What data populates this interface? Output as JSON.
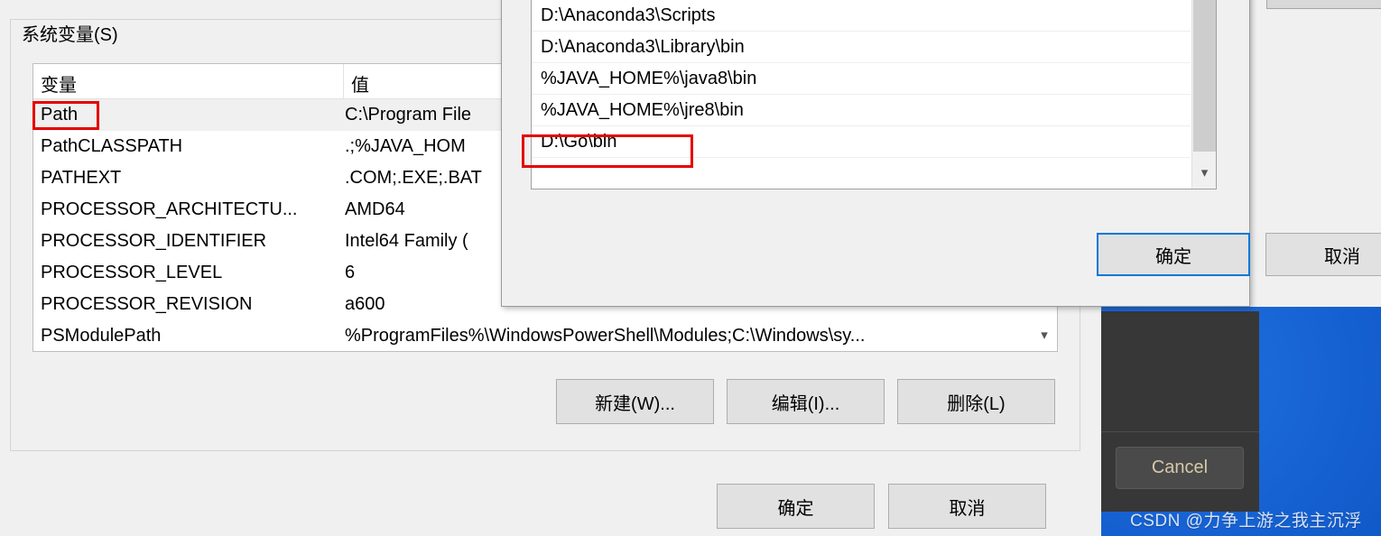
{
  "outer_dialog": {
    "group_title": "系统变量(S)",
    "table": {
      "headers": [
        "变量",
        "值"
      ],
      "rows": [
        {
          "name": "Path",
          "value": "C:\\Program File",
          "selected": true
        },
        {
          "name": "PathCLASSPATH",
          "value": " .;%JAVA_HOM",
          "selected": false
        },
        {
          "name": "PATHEXT",
          "value": ".COM;.EXE;.BAT",
          "selected": false
        },
        {
          "name": "PROCESSOR_ARCHITECTU...",
          "value": "AMD64",
          "selected": false
        },
        {
          "name": "PROCESSOR_IDENTIFIER",
          "value": "Intel64 Family (",
          "selected": false
        },
        {
          "name": "PROCESSOR_LEVEL",
          "value": "6",
          "selected": false
        },
        {
          "name": "PROCESSOR_REVISION",
          "value": "a600",
          "selected": false
        },
        {
          "name": "PSModulePath",
          "value": "%ProgramFiles%\\WindowsPowerShell\\Modules;C:\\Windows\\sy...",
          "selected": false
        }
      ],
      "scroll_down_icon": "chevron-down-icon"
    },
    "buttons": {
      "new": "新建(W)...",
      "edit": "编辑(I)...",
      "delete": "删除(L)",
      "ok": "确定",
      "cancel": "取消"
    }
  },
  "edit_dialog": {
    "path_entries": [
      "D:\\Anaconda3\\Scripts",
      "D:\\Anaconda3\\Library\\bin",
      "%JAVA_HOME%\\java8\\bin",
      "%JAVA_HOME%\\jre8\\bin",
      "D:\\Go\\bin"
    ],
    "scroll_down_icon": "chevron-down-icon",
    "buttons": {
      "ok": "确定",
      "cancel": "取消"
    }
  },
  "annotations": {
    "color": "#e60000",
    "highlighted_variable": "Path",
    "highlighted_path_entry": "D:\\Go\\bin"
  },
  "background": {
    "cancel_button": "Cancel",
    "watermark": "CSDN @力争上游之我主沉浮",
    "blue_color": "#1565d8",
    "panel_color": "#373737"
  }
}
